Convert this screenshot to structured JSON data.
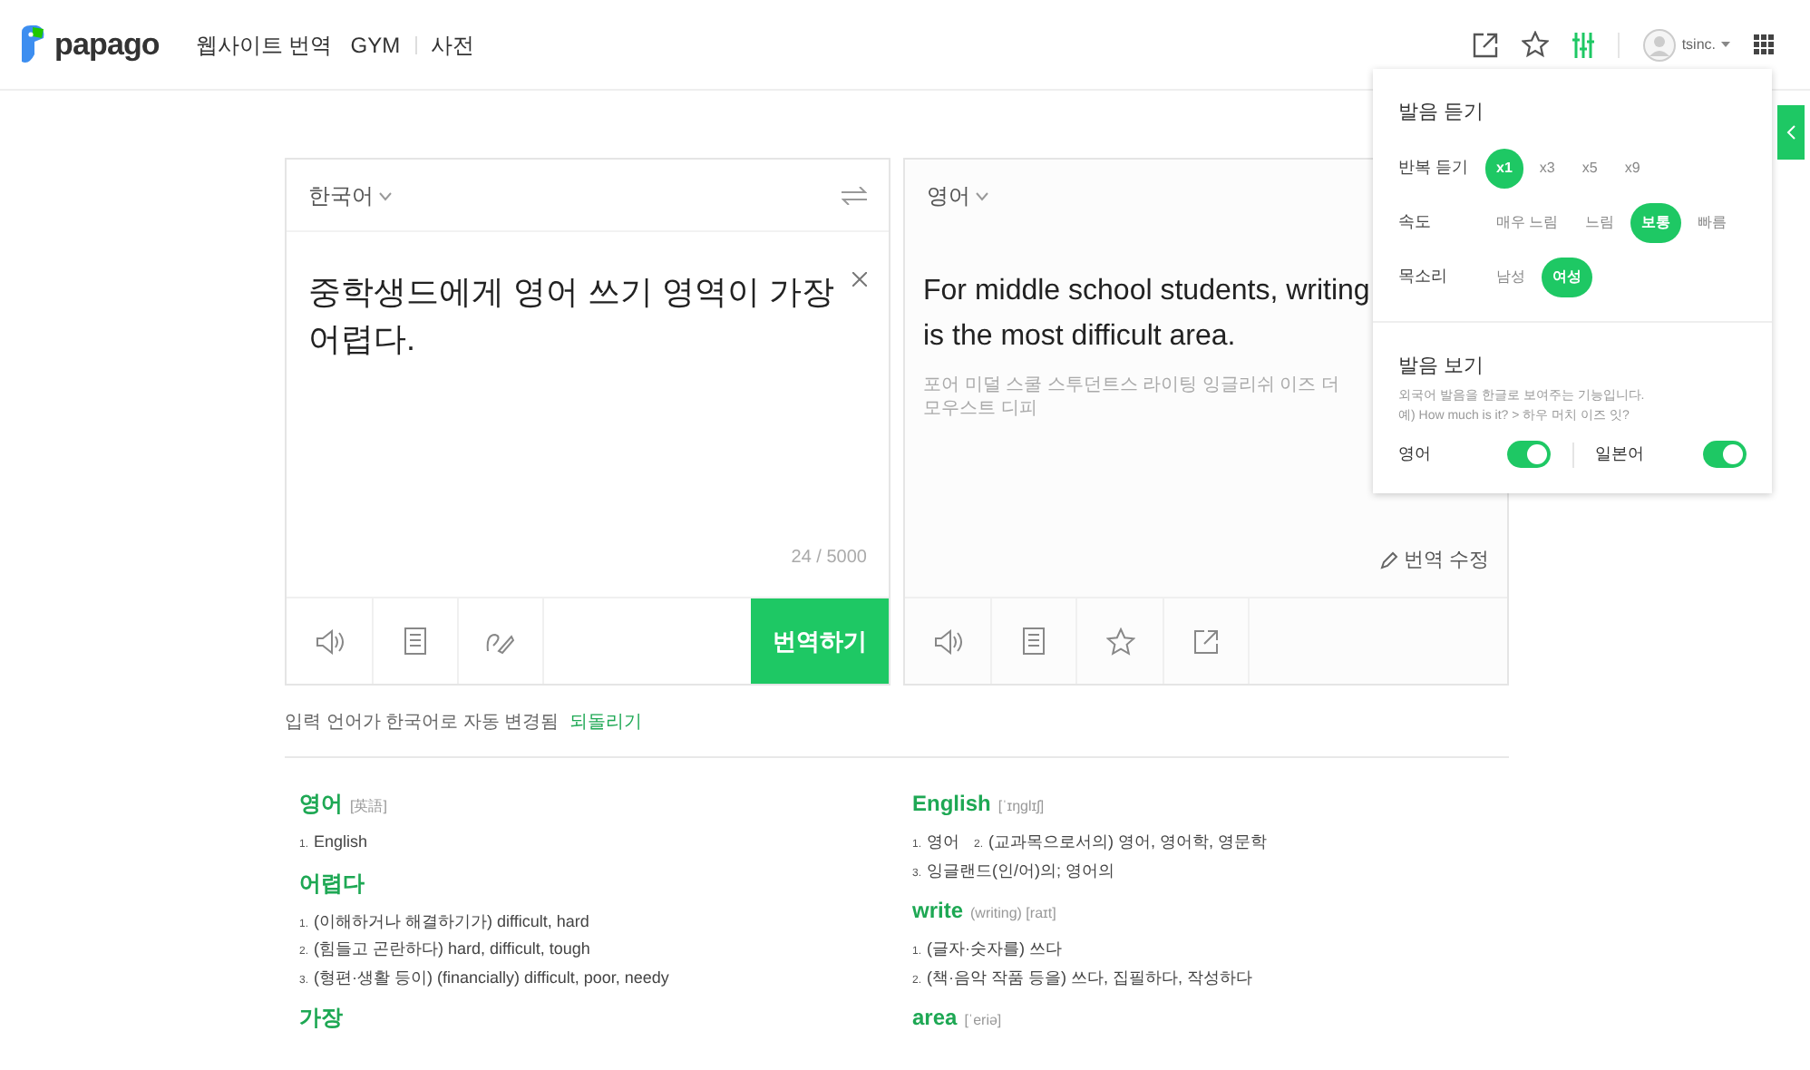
{
  "header": {
    "logo": "papago",
    "nav": [
      "웹사이트 번역",
      "GYM",
      "사전"
    ],
    "settings_open": true,
    "user": "tsinc."
  },
  "source": {
    "language": "한국어",
    "text": "중학생드에게 영어 쓰기 영역이 가장 어렵다.",
    "count": "24 / 5000",
    "translate_button": "번역하기"
  },
  "target": {
    "language": "영어",
    "text": "For middle school students, writing is the most difficult area.",
    "pronunciation": "포어 미덜 스쿨 스투던트스 라이팅 잉글리쉬 이즈 더 모우스트 디피",
    "edit_link": "번역 수정"
  },
  "notice": {
    "text": "입력 언어가 한국어로 자동 변경됨",
    "link": "되돌리기"
  },
  "dictionary": {
    "columns": [
      [
        {
          "word": "영어",
          "extra": "[英語]",
          "lines": [
            [
              {
                "num": "1.",
                "text": "English"
              }
            ]
          ]
        },
        {
          "word": "어렵다",
          "lines": [
            [
              {
                "num": "1.",
                "text": "(이해하거나 해결하기가) difficult, hard"
              }
            ],
            [
              {
                "num": "2.",
                "text": "(힘들고 곤란하다) hard, difficult, tough"
              }
            ],
            [
              {
                "num": "3.",
                "text": "(형편·생활 등이) (financially) difficult, poor, needy"
              }
            ]
          ]
        },
        {
          "word": "가장"
        }
      ],
      [
        {
          "word": "English",
          "extra": "[ˈɪŋɡlɪʃ]",
          "lines": [
            [
              {
                "num": "1.",
                "text": "영어"
              },
              {
                "num": "2.",
                "text": "(교과목으로서의) 영어, 영어학, 영문학"
              }
            ],
            [
              {
                "num": "3.",
                "text": "잉글랜드(인/어)의; 영어의"
              }
            ]
          ]
        },
        {
          "word": "write",
          "extra": "(writing) [raɪt]",
          "lines": [
            [
              {
                "num": "1.",
                "text": "(글자·숫자를) 쓰다"
              }
            ],
            [
              {
                "num": "2.",
                "text": "(책·음악 작품 등을) 쓰다, 집필하다, 작성하다"
              }
            ]
          ]
        },
        {
          "word": "area",
          "extra": "[ˈeriə]"
        }
      ]
    ]
  },
  "pronunciation_panel": {
    "listen_title": "발음 듣기",
    "settings": [
      {
        "label": "반복 듣기",
        "options": [
          {
            "label": "x1",
            "selected": true
          },
          {
            "label": "x3",
            "selected": false
          },
          {
            "label": "x5",
            "selected": false
          },
          {
            "label": "x9",
            "selected": false
          }
        ]
      },
      {
        "label": "속도",
        "options": [
          {
            "label": "매우 느림",
            "selected": false
          },
          {
            "label": "느림",
            "selected": false
          },
          {
            "label": "보통",
            "selected": true
          },
          {
            "label": "빠름",
            "selected": false
          }
        ]
      },
      {
        "label": "목소리",
        "options": [
          {
            "label": "남성",
            "selected": false
          },
          {
            "label": "여성",
            "selected": true
          }
        ]
      }
    ],
    "view_title": "발음 보기",
    "description": [
      "외국어 발음을 한글로 보여주는 기능입니다.",
      "예) How much is it? > 하우 머치 이즈 잇?"
    ],
    "toggles": [
      {
        "label": "영어",
        "on": true
      },
      {
        "label": "일본어",
        "on": true
      }
    ]
  }
}
